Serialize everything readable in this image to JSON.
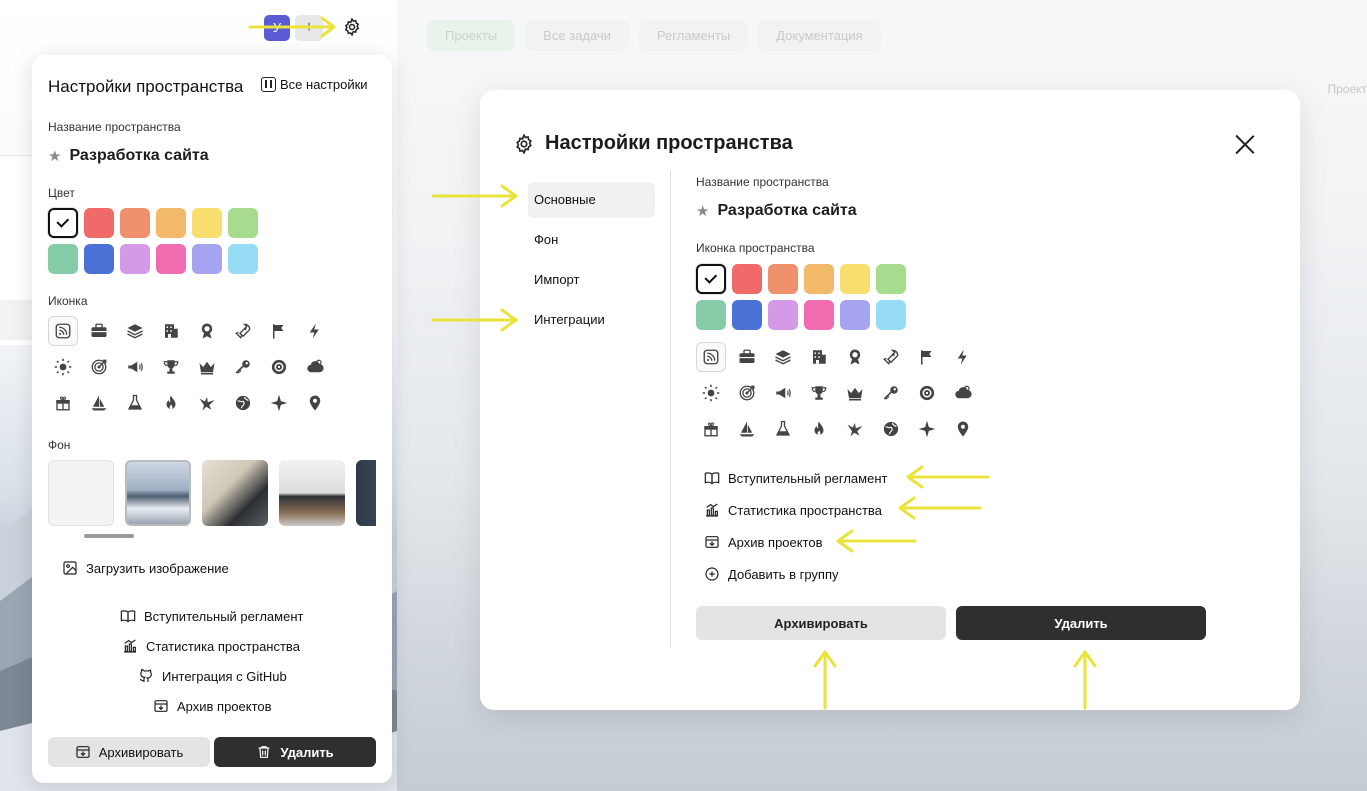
{
  "topbar": {
    "avatar_letter": "У",
    "plus_label": "+"
  },
  "background_tabs": [
    "Проекты",
    "Все задачи",
    "Регламенты",
    "Документация"
  ],
  "background_side_text": "Проект",
  "panel": {
    "title": "Настройки пространства",
    "all_settings": "Все настройки",
    "name_label": "Название пространства",
    "name_value": "Разработка сайта",
    "color_label": "Цвет",
    "icon_label": "Иконка",
    "bg_label": "Фон",
    "upload_image": "Загрузить изображение",
    "links": [
      "Вступительный регламент",
      "Статистика пространства",
      "Интеграция с GitHub",
      "Архив проектов"
    ],
    "archive_button": "Архивировать",
    "delete_button": "Удалить"
  },
  "modal": {
    "title": "Настройки пространства",
    "nav": [
      "Основные",
      "Фон",
      "Импорт",
      "Интеграции"
    ],
    "name_label": "Название пространства",
    "name_value": "Разработка сайта",
    "icon_label": "Иконка пространства",
    "links": [
      "Вступительный регламент",
      "Статистика пространства",
      "Архив проектов",
      "Добавить в группу"
    ],
    "archive_button": "Архивировать",
    "delete_button": "Удалить"
  },
  "colors": {
    "swatches": [
      "#ffffff",
      "#f06a6a",
      "#f0916d",
      "#f2b96a",
      "#f7de6e",
      "#a7db8e",
      "#86cca8",
      "#4a72d6",
      "#d49ae8",
      "#f06bb0",
      "#a6a3f0",
      "#96dcf4"
    ],
    "annotation": "#e9e33a",
    "avatar": "#5b5bd6"
  },
  "icon_names": [
    "rss",
    "briefcase",
    "layers",
    "building",
    "badge",
    "rocket",
    "flag",
    "bolt",
    "sun",
    "target",
    "megaphone",
    "trophy",
    "crown",
    "key",
    "aperture",
    "cloud",
    "gift",
    "sailboat",
    "flask",
    "flame",
    "bird",
    "globe",
    "sparkles",
    "map-pin"
  ]
}
